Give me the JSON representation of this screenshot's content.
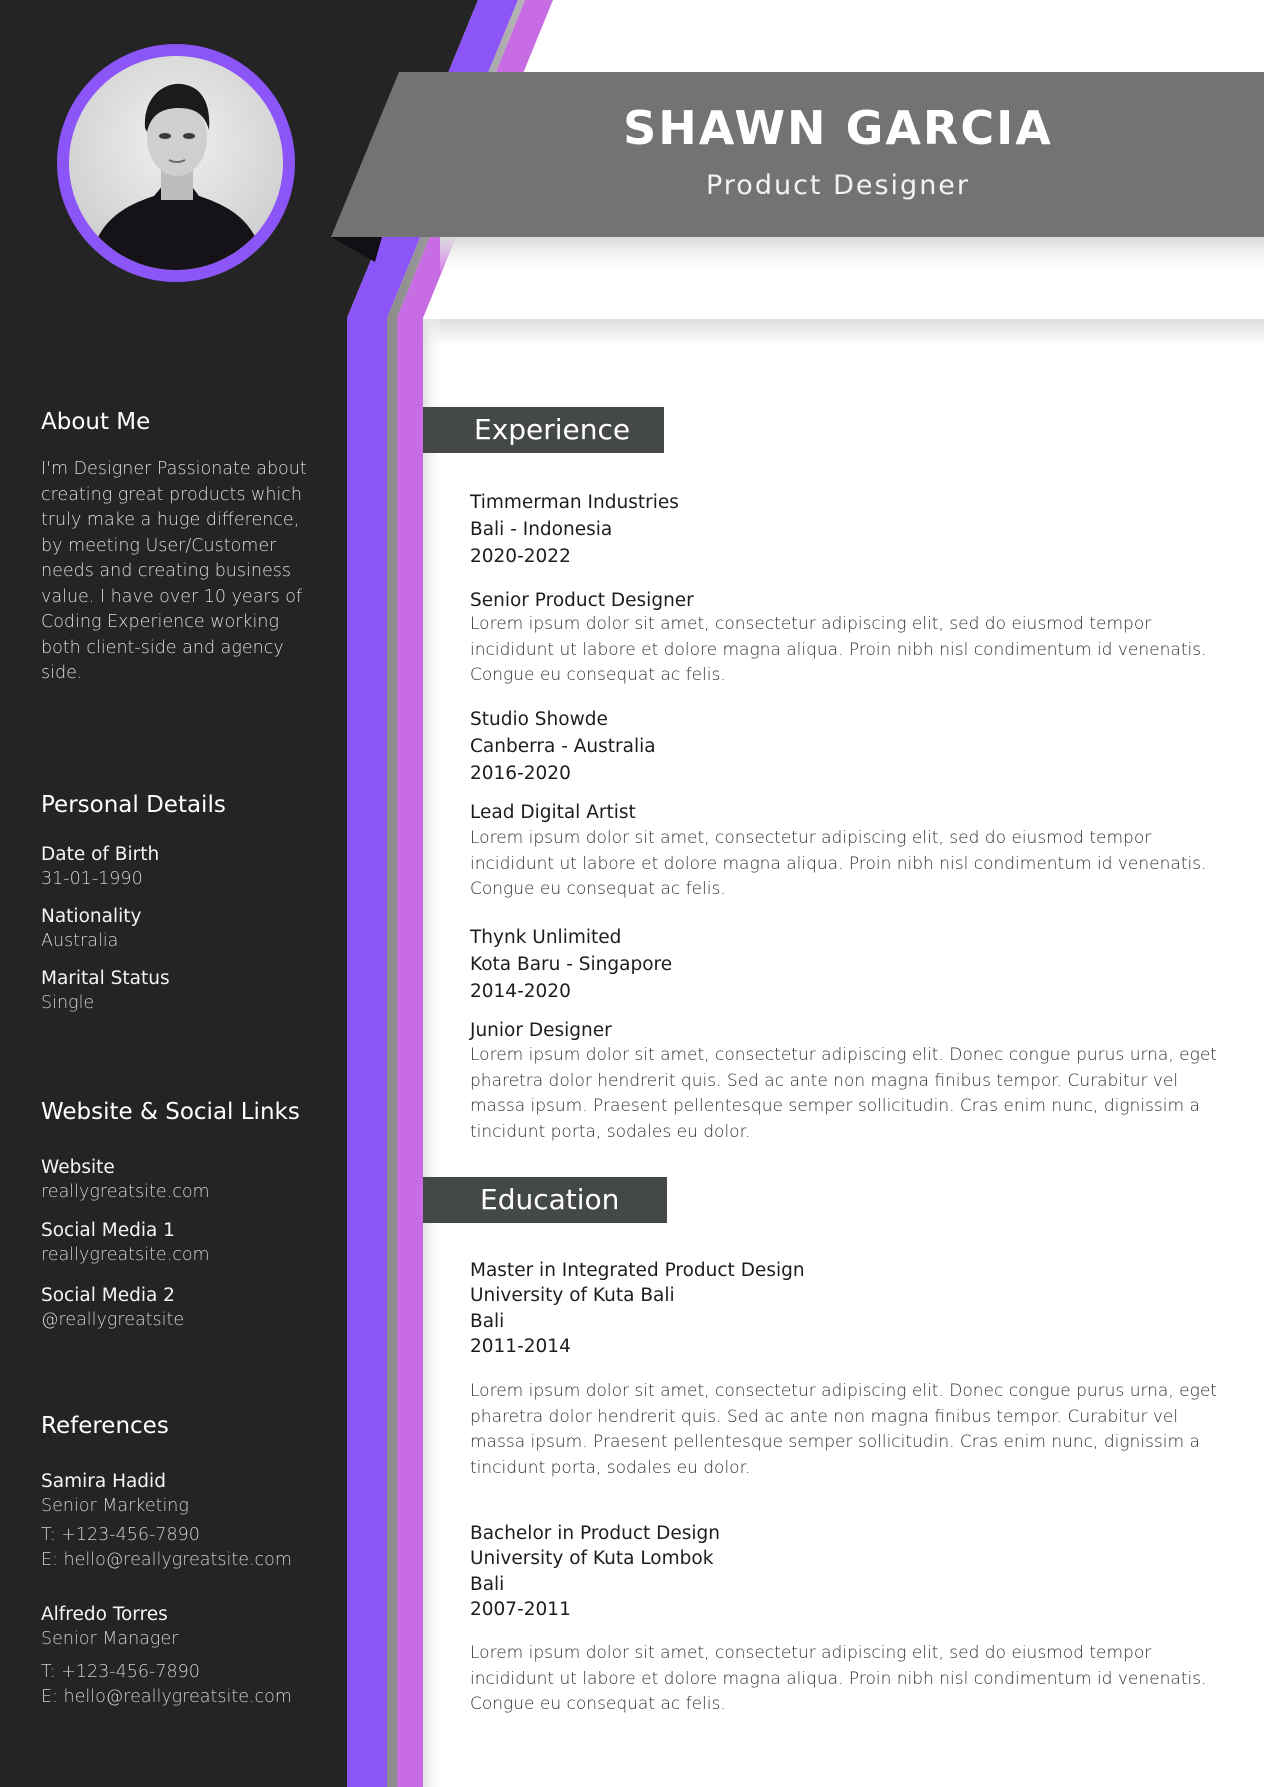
{
  "header": {
    "name": "SHAWN GARCIA",
    "title": "Product Designer"
  },
  "colors": {
    "sidebar_bg": "#242424",
    "accent_purple": "#8b55f7",
    "accent_pink": "#c86ce3",
    "banner_gray": "#737373",
    "section_box": "#454849"
  },
  "sidebar": {
    "about": {
      "heading": "About Me",
      "text": "I'm Designer Passionate about creating great products which truly make a huge difference, by meeting User/Customer needs and creating business value. I have over 10 years of Coding Experience working both client-side and agency side."
    },
    "personal": {
      "heading": "Personal Details",
      "items": [
        {
          "label": "Date of Birth",
          "value": "31-01-1990"
        },
        {
          "label": "Nationality",
          "value": "Australia"
        },
        {
          "label": "Marital Status",
          "value": "Single"
        }
      ]
    },
    "links": {
      "heading": "Website & Social Links",
      "items": [
        {
          "label": "Website",
          "value": "reallygreatsite.com"
        },
        {
          "label": "Social Media 1",
          "value": "reallygreatsite.com"
        },
        {
          "label": "Social Media 2",
          "value": "@reallygreatsite"
        }
      ]
    },
    "references": {
      "heading": "References",
      "items": [
        {
          "name": "Samira Hadid",
          "role": "Senior Marketing",
          "phone": "T: +123-456-7890",
          "email": "E: hello@reallygreatsite.com"
        },
        {
          "name": "Alfredo Torres",
          "role": "Senior Manager",
          "phone": "T: +123-456-7890",
          "email": "E: hello@reallygreatsite.com"
        }
      ]
    }
  },
  "experience": {
    "heading": "Experience",
    "items": [
      {
        "company": "Timmerman Industries",
        "location": "Bali - Indonesia",
        "years": "2020-2022",
        "role": "Senior Product Designer",
        "description": "Lorem ipsum dolor sit amet, consectetur adipiscing elit, sed do eiusmod tempor incididunt ut labore et dolore magna aliqua. Proin nibh nisl condimentum id venenatis. Congue eu consequat ac felis."
      },
      {
        "company": "Studio Showde",
        "location": "Canberra - Australia",
        "years": "2016-2020",
        "role": "Lead Digital Artist",
        "description": "Lorem ipsum dolor sit amet, consectetur adipiscing elit, sed do eiusmod tempor incididunt ut labore et dolore magna aliqua. Proin nibh nisl condimentum id venenatis. Congue eu consequat ac felis."
      },
      {
        "company": "Thynk Unlimited",
        "location": "Kota Baru - Singapore",
        "years": "2014-2020",
        "role": "Junior Designer",
        "description": "Lorem ipsum dolor sit amet, consectetur adipiscing elit. Donec congue purus urna, eget pharetra dolor hendrerit quis. Sed ac ante non magna finibus tempor. Curabitur vel massa ipsum. Praesent pellentesque semper sollicitudin. Cras enim nunc, dignissim a tincidunt porta, sodales eu dolor."
      }
    ]
  },
  "education": {
    "heading": "Education",
    "items": [
      {
        "degree": "Master in Integrated Product Design",
        "school": "University of Kuta Bali",
        "location": "Bali",
        "years": "2011-2014",
        "description": "Lorem ipsum dolor sit amet, consectetur adipiscing elit. Donec congue purus urna, eget pharetra dolor hendrerit quis. Sed ac ante non magna finibus tempor. Curabitur vel massa ipsum. Praesent pellentesque semper sollicitudin. Cras enim nunc, dignissim a tincidunt porta, sodales eu dolor."
      },
      {
        "degree": "Bachelor in Product Design",
        "school": "University of Kuta Lombok",
        "location": "Bali",
        "years": "2007-2011",
        "description": "Lorem ipsum dolor sit amet, consectetur adipiscing elit, sed do eiusmod tempor incididunt ut labore et dolore magna aliqua. Proin nibh nisl condimentum id venenatis. Congue eu consequat ac felis."
      }
    ]
  }
}
